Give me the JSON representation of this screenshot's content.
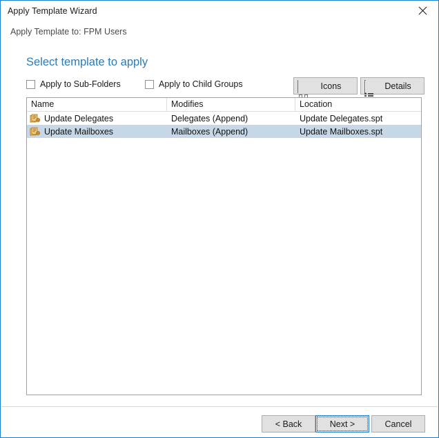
{
  "window": {
    "title": "Apply Template Wizard",
    "close_icon": "close-icon"
  },
  "subtitle": "Apply Template to: FPM Users",
  "heading": "Select template to apply",
  "options": {
    "sub_folders": {
      "label": "Apply to Sub-Folders",
      "checked": false
    },
    "child_groups": {
      "label": "Apply to Child Groups",
      "checked": false
    }
  },
  "view_buttons": [
    {
      "label": "Icons",
      "icon": "icons-view-icon"
    },
    {
      "label": "Details",
      "icon": "details-view-icon"
    }
  ],
  "list": {
    "columns": [
      "Name",
      "Modifies",
      "Location"
    ],
    "rows": [
      {
        "icon": "template-document-stack-icon",
        "name": "Update Delegates",
        "modifies": "Delegates (Append)",
        "location": "Update Delegates.spt",
        "selected": false
      },
      {
        "icon": "template-document-stack-icon",
        "name": "Update Mailboxes",
        "modifies": "Mailboxes (Append)",
        "location": "Update Mailboxes.spt",
        "selected": true
      }
    ]
  },
  "footer": {
    "back": "< Back",
    "next": "Next >",
    "cancel": "Cancel"
  },
  "colors": {
    "window_border": "#1b7fcf",
    "heading": "#2a7ab9",
    "selection": "#c6d7e7",
    "button_face": "#e1e1e1",
    "icon_accent": "#4aab8a",
    "row_icon": "#e0a23c"
  }
}
